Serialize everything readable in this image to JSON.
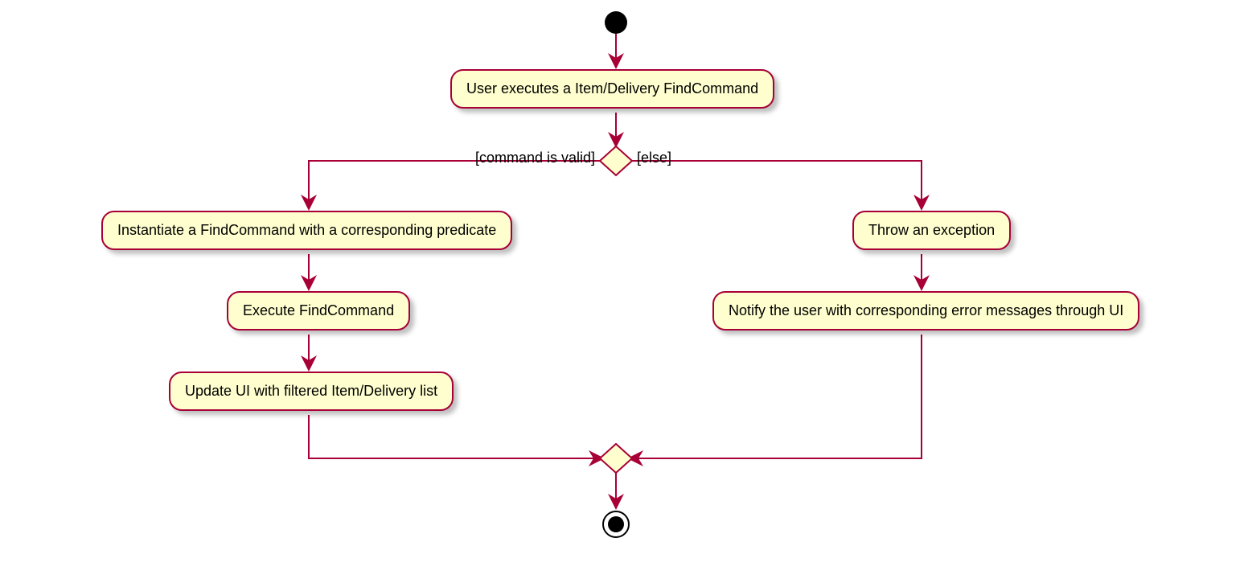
{
  "diagram": {
    "type": "uml-activity",
    "nodes": {
      "start": {
        "kind": "initial"
      },
      "a1": {
        "text": "User executes a Item/Delivery FindCommand"
      },
      "decision1": {
        "kind": "decision"
      },
      "labelLeft": {
        "text": "[command is valid]"
      },
      "labelRight": {
        "text": "[else]"
      },
      "b1": {
        "text": "Instantiate a FindCommand with a corresponding predicate"
      },
      "b2": {
        "text": "Execute FindCommand"
      },
      "b3": {
        "text": "Update UI with filtered Item/Delivery list"
      },
      "c1": {
        "text": "Throw an exception"
      },
      "c2": {
        "text": "Notify the user with corresponding error messages through UI"
      },
      "merge": {
        "kind": "merge"
      },
      "end": {
        "kind": "final"
      }
    },
    "edges": [
      [
        "start",
        "a1"
      ],
      [
        "a1",
        "decision1"
      ],
      [
        "decision1",
        "b1",
        "command is valid"
      ],
      [
        "decision1",
        "c1",
        "else"
      ],
      [
        "b1",
        "b2"
      ],
      [
        "b2",
        "b3"
      ],
      [
        "b3",
        "merge"
      ],
      [
        "c1",
        "c2"
      ],
      [
        "c2",
        "merge"
      ],
      [
        "merge",
        "end"
      ]
    ]
  }
}
